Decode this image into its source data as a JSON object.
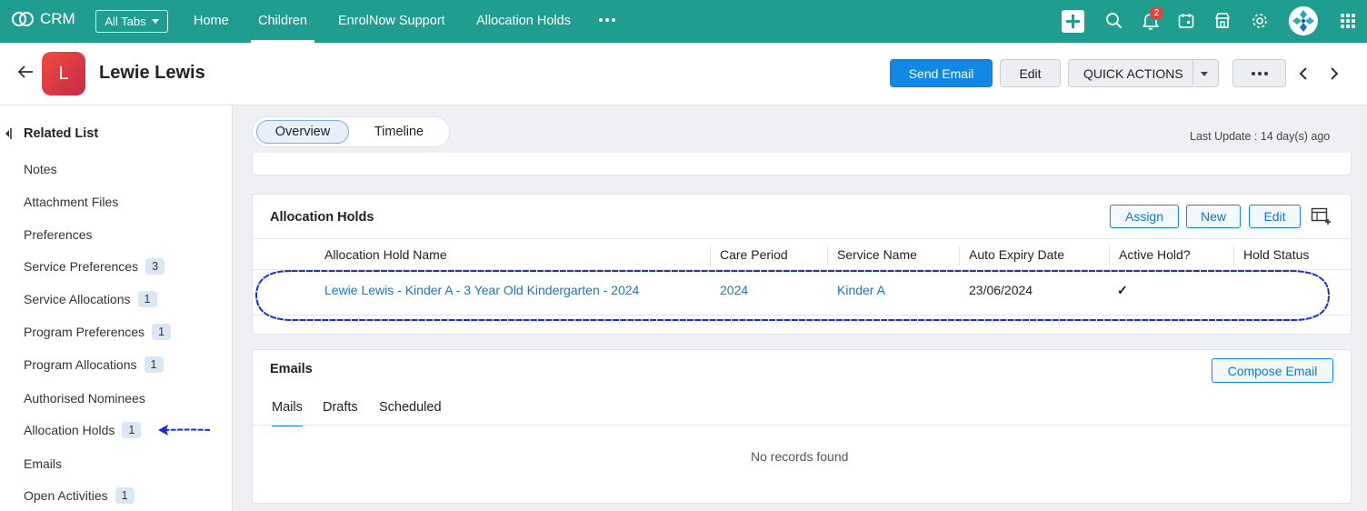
{
  "topbar": {
    "app_name": "CRM",
    "all_tabs_label": "All Tabs",
    "tabs": [
      {
        "label": "Home"
      },
      {
        "label": "Children"
      },
      {
        "label": "EnrolNow Support"
      },
      {
        "label": "Allocation Holds"
      }
    ],
    "active_tab": "Children",
    "notification_count": "2",
    "icons": [
      "plus-icon",
      "search-icon",
      "bell-icon",
      "calendar-icon",
      "store-icon",
      "gear-icon",
      "user-avatar",
      "app-grid-icon"
    ],
    "bar_color": "#1f9e8f"
  },
  "record": {
    "avatar_letter": "L",
    "name": "Lewie Lewis",
    "buttons": {
      "send_email": "Send Email",
      "edit": "Edit",
      "quick_actions": "QUICK ACTIONS"
    }
  },
  "sidebar": {
    "title": "Related List",
    "items": [
      {
        "label": "Notes",
        "count": null
      },
      {
        "label": "Attachment Files",
        "count": null
      },
      {
        "label": "Preferences",
        "count": null
      },
      {
        "label": "Service Preferences",
        "count": "3"
      },
      {
        "label": "Service Allocations",
        "count": "1"
      },
      {
        "label": "Program Preferences",
        "count": "1"
      },
      {
        "label": "Program Allocations",
        "count": "1"
      },
      {
        "label": "Authorised Nominees",
        "count": null
      },
      {
        "label": "Allocation Holds",
        "count": "1"
      },
      {
        "label": "Emails",
        "count": null
      },
      {
        "label": "Open Activities",
        "count": "1"
      }
    ]
  },
  "view": {
    "segments": [
      "Overview",
      "Timeline"
    ],
    "active_segment": "Overview",
    "last_update": "Last Update : 14 day(s) ago"
  },
  "allocation_holds": {
    "title": "Allocation Holds",
    "buttons": {
      "assign": "Assign",
      "new": "New",
      "edit": "Edit"
    },
    "columns": [
      "Allocation Hold Name",
      "Care Period",
      "Service Name",
      "Auto Expiry Date",
      "Active Hold?",
      "Hold Status"
    ],
    "rows": [
      {
        "name": "Lewie Lewis - Kinder A - 3 Year Old Kindergarten - 2024",
        "care_period": "2024",
        "service_name": "Kinder A",
        "auto_expiry_date": "23/06/2024",
        "active_hold": "✓",
        "hold_status": ""
      }
    ]
  },
  "emails": {
    "title": "Emails",
    "compose_label": "Compose Email",
    "tabs": [
      "Mails",
      "Drafts",
      "Scheduled"
    ],
    "active_tab": "Mails",
    "empty_text": "No records found"
  },
  "colors": {
    "accent": "#1188e5",
    "link": "#1177cc",
    "annotation": "#1a2fd6"
  }
}
